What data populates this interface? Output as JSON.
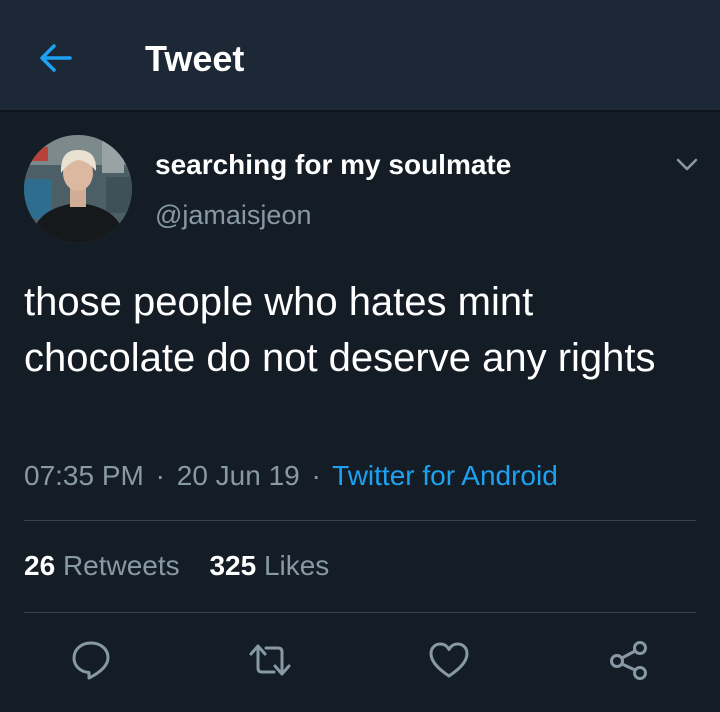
{
  "header": {
    "back_icon": "arrow-left-icon",
    "title": "Tweet"
  },
  "tweet": {
    "display_name": "searching for my soulmate",
    "handle": "@jamaisjeon",
    "text": "those people who hates mint chocolate do not deserve any rights",
    "time": "07:35 PM",
    "date": "20 Jun 19",
    "source": "Twitter for Android",
    "separator": "·"
  },
  "stats": {
    "retweets_count": "26",
    "retweets_label": "Retweets",
    "likes_count": "325",
    "likes_label": "Likes"
  },
  "actions": [
    {
      "icon": "reply-icon"
    },
    {
      "icon": "retweet-icon"
    },
    {
      "icon": "like-icon"
    },
    {
      "icon": "share-icon"
    }
  ],
  "colors": {
    "background": "#141d26",
    "header_background": "#1c2836",
    "text_primary": "#ffffff",
    "text_secondary": "#8899a6",
    "accent": "#1da1f2",
    "divider": "#38444d"
  }
}
